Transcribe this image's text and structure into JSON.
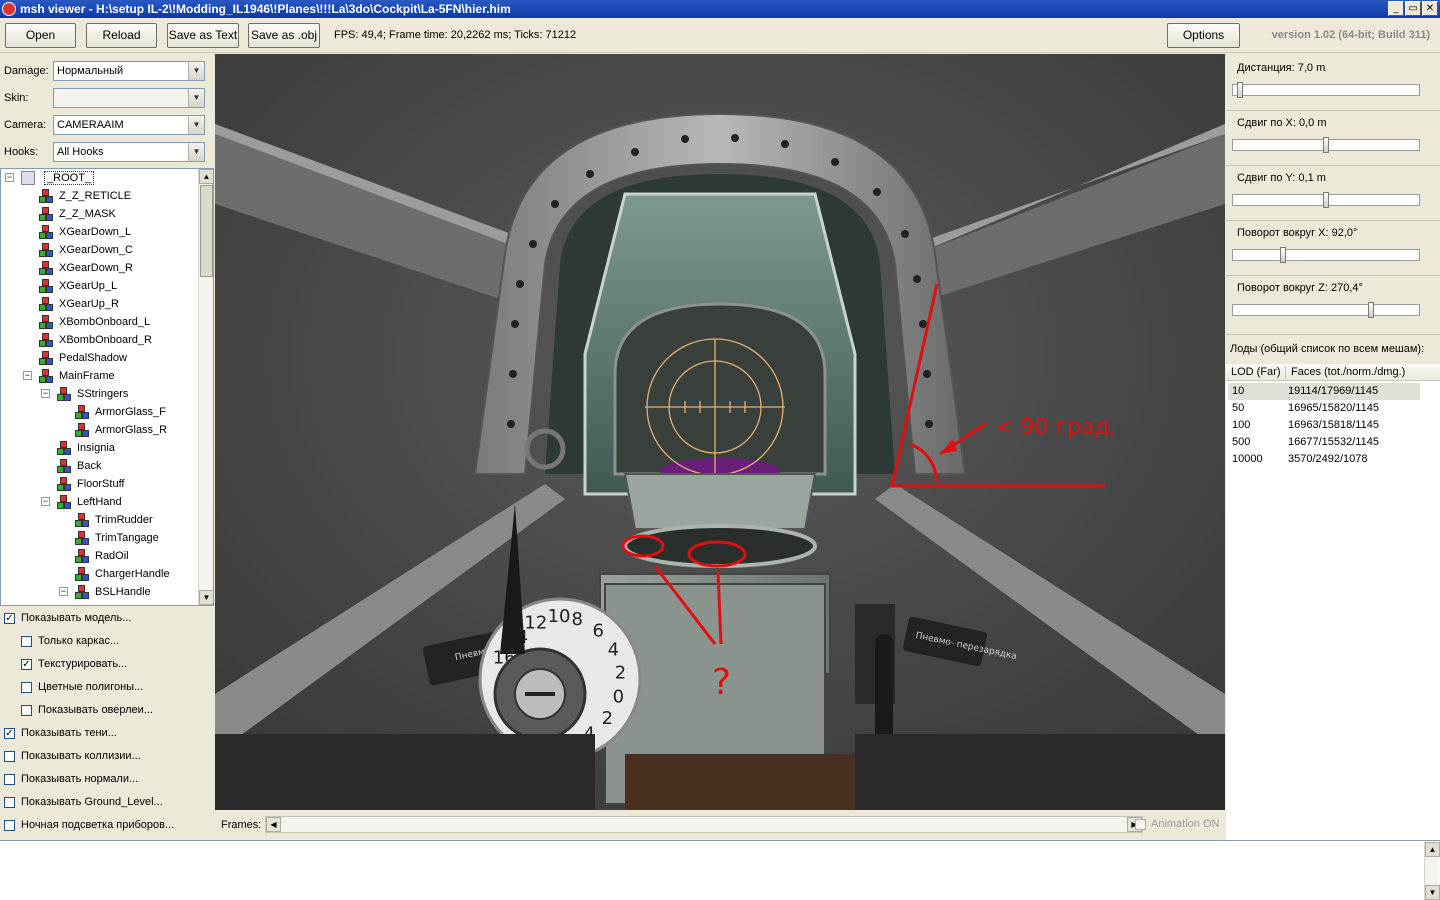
{
  "window": {
    "title": "msh viewer - H:\\setup IL-2\\!Modding_IL1946\\!Planes\\!!!La\\3do\\Cockpit\\La-5FN\\hier.him",
    "min_glyph": "_",
    "max_glyph": "▭",
    "close_glyph": "✕"
  },
  "toolbar": {
    "open_label": "Open",
    "reload_label": "Reload",
    "save_text_label": "Save as Text",
    "save_obj_label": "Save as .obj",
    "stats": "FPS: 49,4; Frame time: 20,2262 ms; Ticks: 71212",
    "options_label": "Options",
    "version": "version 1.02 (64-bit; Build 311)"
  },
  "left": {
    "damage_label": "Damage:",
    "damage_value": "Нормальный",
    "skin_label": "Skin:",
    "skin_value": "",
    "camera_label": "Camera:",
    "camera_value": "CAMERAAIM",
    "hooks_label": "Hooks:",
    "hooks_value": "All Hooks"
  },
  "tree": {
    "root": "_ROOT_",
    "nodes": [
      "Z_Z_RETICLE",
      "Z_Z_MASK",
      "XGearDown_L",
      "XGearDown_C",
      "XGearDown_R",
      "XGearUp_L",
      "XGearUp_R",
      "XBombOnboard_L",
      "XBombOnboard_R",
      "PedalShadow",
      "MainFrame",
      "SStringers",
      "ArmorGlass_F",
      "ArmorGlass_R",
      "Insignia",
      "Back",
      "FloorStuff",
      "LeftHand",
      "TrimRudder",
      "TrimTangage",
      "RadOil",
      "ChargerHandle",
      "BSLHandle"
    ]
  },
  "checkboxes": [
    {
      "label": "Показывать модель...",
      "checked": true
    },
    {
      "label": "Только каркас...",
      "checked": false
    },
    {
      "label": "Текстурировать...",
      "checked": true
    },
    {
      "label": "Цветные полигоны...",
      "checked": false
    },
    {
      "label": "Показывать оверлеи...",
      "checked": false
    },
    {
      "label": "Показывать тени...",
      "checked": true
    },
    {
      "label": "Показывать коллизии...",
      "checked": false
    },
    {
      "label": "Показывать нормали...",
      "checked": false
    },
    {
      "label": "Показывать Ground_Level...",
      "checked": false
    },
    {
      "label": "Ночная подсветка приборов...",
      "checked": false
    }
  ],
  "viewport": {
    "annotation_angle": "< 90 град.",
    "annotation_question": "?",
    "placard_left": "Пневмо- перезарядка",
    "placard_right": "Пневмо- перезарядка",
    "dial_numbers": [
      "16",
      "14",
      "12",
      "10",
      "8",
      "6",
      "4",
      "2",
      "0",
      "2",
      "4"
    ],
    "annotation_color": "#e01010"
  },
  "frames": {
    "label": "Frames:",
    "animation_label": "Animation ON"
  },
  "right": {
    "distance_label": "Дистанция:  7,0 m",
    "distance_level": 0.02,
    "shift_x_label": "Сдвиг по X:  0,0 m",
    "shift_x_level": 0.5,
    "shift_y_label": "Сдвиг по Y:  0,1 m",
    "shift_y_level": 0.5,
    "rot_x_label": "Поворот вокруг X:  92,0°",
    "rot_x_level": 0.26,
    "rot_z_label": "Поворот вокруг Z:  270,4°",
    "rot_z_level": 0.75,
    "lod_title": "Лоды (общий список по всем мешам):",
    "lod_col1": "LOD (Far)",
    "lod_col2": "Faces (tot./norm./dmg.)",
    "lods": [
      {
        "lod": "10",
        "faces": "19114/17969/1145"
      },
      {
        "lod": "50",
        "faces": "16965/15820/1145"
      },
      {
        "lod": "100",
        "faces": "16963/15818/1145"
      },
      {
        "lod": "500",
        "faces": "16677/15532/1145"
      },
      {
        "lod": "10000",
        "faces": "3570/2492/1078"
      }
    ]
  },
  "scroll": {
    "up_glyph": "▲",
    "down_glyph": "▼",
    "left_glyph": "◀",
    "right_glyph": "▶",
    "combo_glyph": "▼"
  }
}
